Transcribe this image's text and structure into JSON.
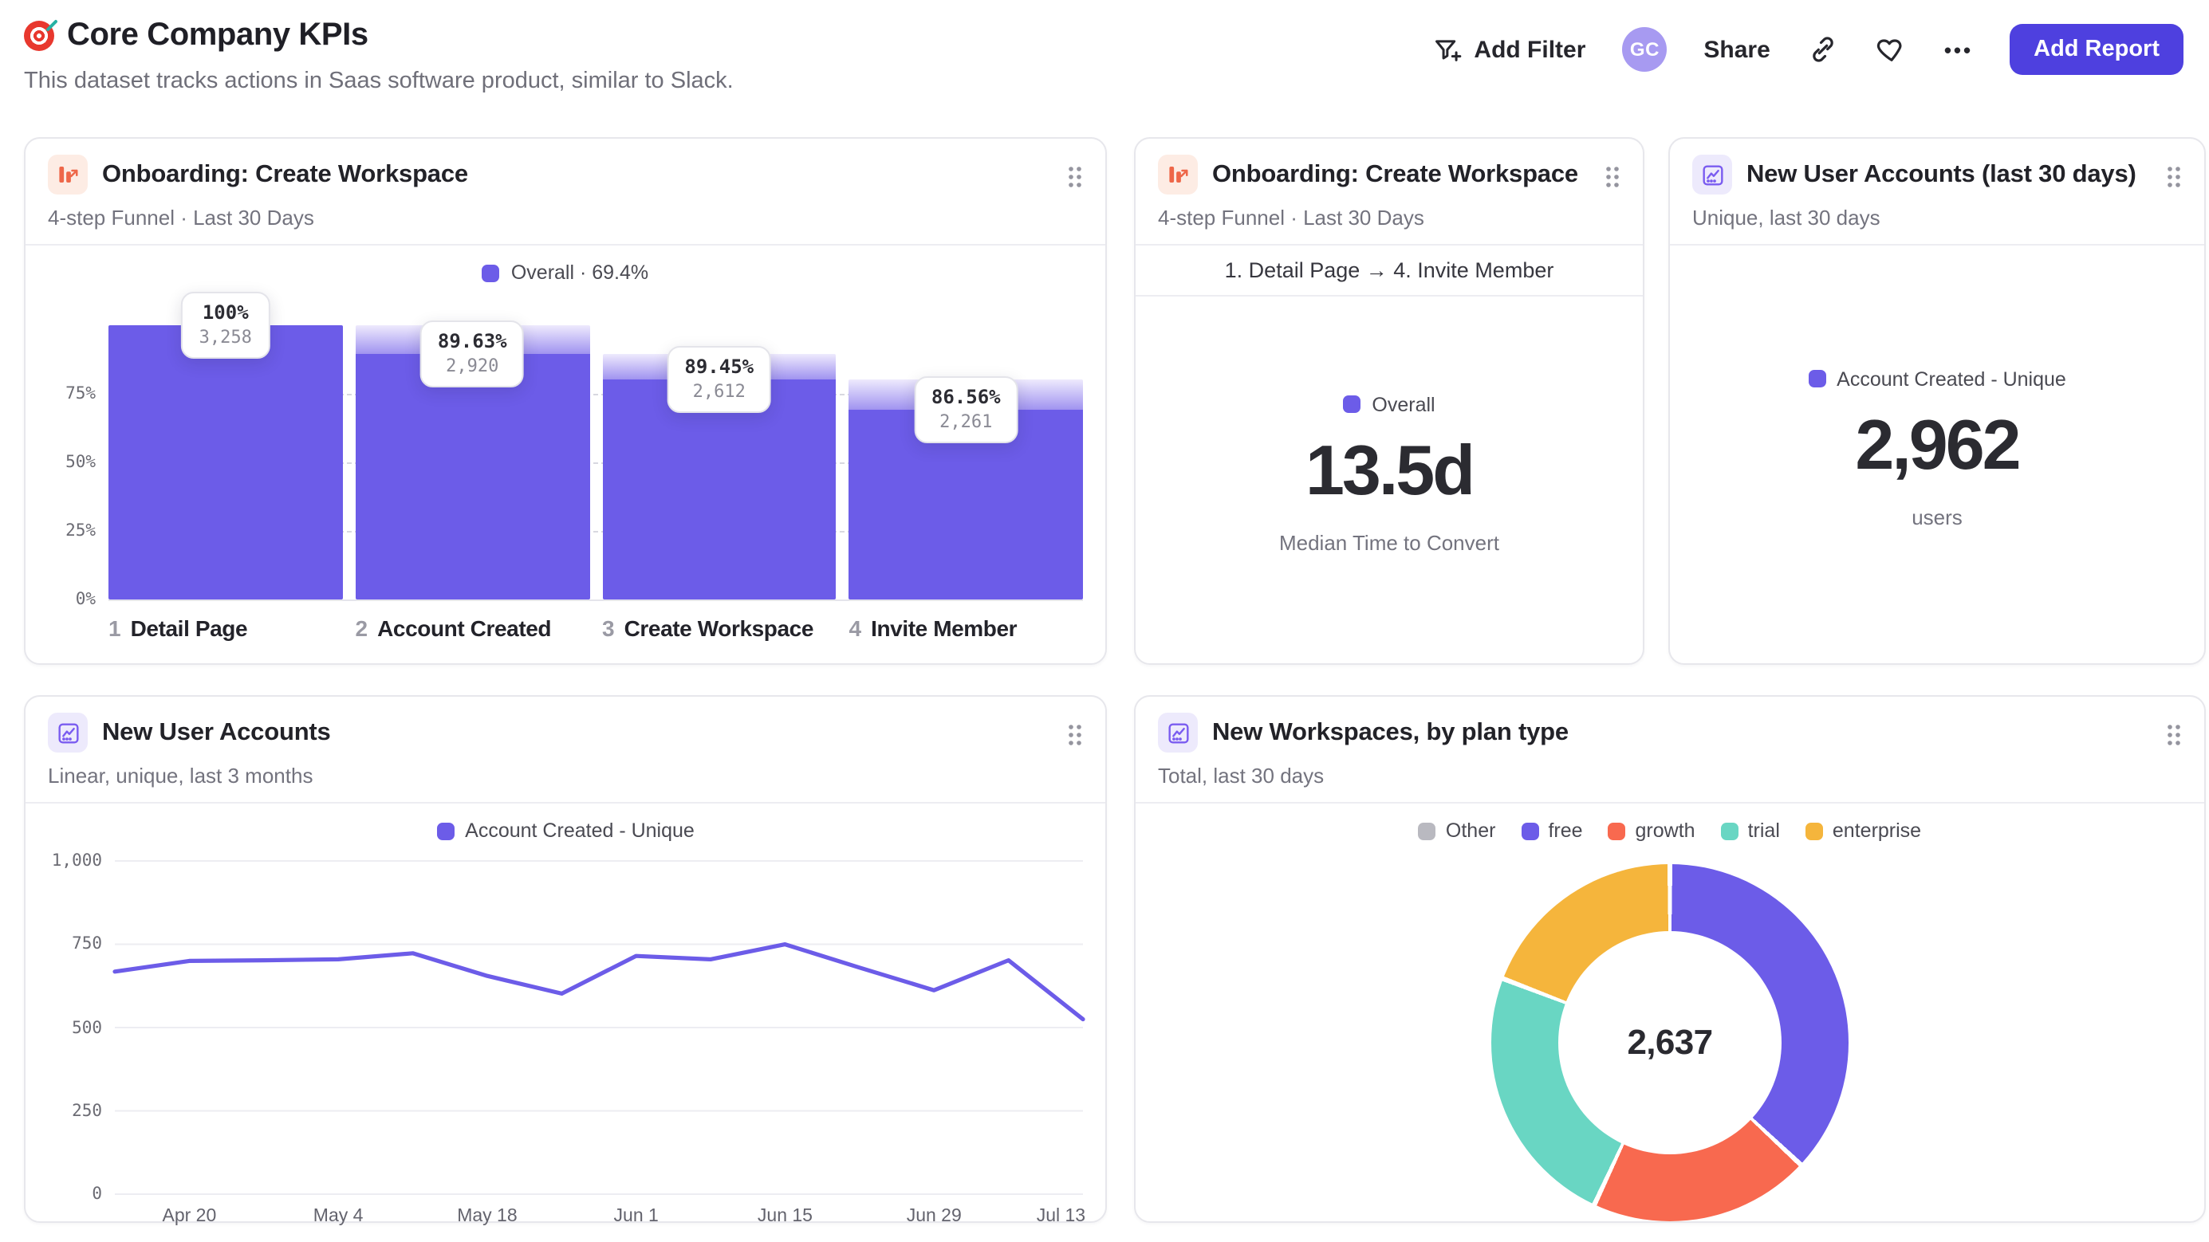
{
  "header": {
    "title": "Core Company KPIs",
    "subtitle": "This dataset tracks actions in Saas software product, similar to Slack.",
    "actions": {
      "add_filter": "Add Filter",
      "avatar_initials": "GC",
      "share": "Share",
      "more": "•••",
      "add_report": "Add Report"
    }
  },
  "colors": {
    "accent_purple": "#6c5ce8",
    "accent_purple_light": "#eeeafd",
    "coral": "#f8694f",
    "teal": "#69d6c3",
    "amber": "#f5b53c",
    "legend_gray": "#b9b9c0",
    "cta_indigo": "#4e40df",
    "avatar_bg": "#a79af1",
    "icon_orange": "#ee6749",
    "icon_orange_bg": "#fdece4",
    "icon_purple": "#7a5cf0",
    "icon_purple_bg": "#edeafc"
  },
  "chart_data": [
    {
      "id": "onboarding-funnel",
      "type": "bar",
      "title": "Onboarding: Create Workspace",
      "subtitle": "4-step Funnel · Last 30 Days",
      "legend_label": "Overall · 69.4%",
      "overall_conversion_pct": 69.4,
      "y_ticks": [
        "75%",
        "50%",
        "25%",
        "0%"
      ],
      "gridlines_pct": [
        75,
        50,
        25
      ],
      "ylim": [
        0,
        100
      ],
      "steps": [
        {
          "index": "1",
          "label": "Detail Page",
          "conversion_pct": "100%",
          "count": "3,258",
          "count_value": 3258,
          "pct_of_first": 100,
          "prev_pct_of_first": 100
        },
        {
          "index": "2",
          "label": "Account Created",
          "conversion_pct": "89.63%",
          "count": "2,920",
          "count_value": 2920,
          "pct_of_first": 89.63,
          "prev_pct_of_first": 100
        },
        {
          "index": "3",
          "label": "Create Workspace",
          "conversion_pct": "89.45%",
          "count": "2,612",
          "count_value": 2612,
          "pct_of_first": 80.18,
          "prev_pct_of_first": 89.63
        },
        {
          "index": "4",
          "label": "Invite Member",
          "conversion_pct": "86.56%",
          "count": "2,261",
          "count_value": 2261,
          "pct_of_first": 69.4,
          "prev_pct_of_first": 80.18
        }
      ]
    },
    {
      "id": "median-time-to-convert",
      "type": "metric",
      "title": "Onboarding: Create Workspace",
      "subtitle": "4-step Funnel · Last 30 Days",
      "range_label": "1. Detail Page → 4. Invite Member",
      "legend_label": "Overall",
      "value": "13.5d",
      "caption": "Median Time to Convert"
    },
    {
      "id": "new-user-accounts-30d",
      "type": "metric",
      "title": "New User Accounts (last 30 days)",
      "subtitle": "Unique, last 30 days",
      "legend_label": "Account Created - Unique",
      "value": "2,962",
      "caption": "users"
    },
    {
      "id": "new-user-accounts-trend",
      "type": "line",
      "title": "New User Accounts",
      "subtitle": "Linear, unique, last 3 months",
      "legend_label": "Account Created - Unique",
      "ylim": [
        0,
        1000
      ],
      "y_ticks": [
        "1,000",
        "750",
        "500",
        "250",
        "0"
      ],
      "x_tick_labels": [
        "Apr 20",
        "May 4",
        "May 18",
        "Jun 1",
        "Jun 15",
        "Jun 29",
        "Jul 13"
      ],
      "x_weekly_dates": [
        "Apr 13",
        "Apr 20",
        "Apr 27",
        "May 4",
        "May 11",
        "May 18",
        "May 25",
        "Jun 1",
        "Jun 8",
        "Jun 15",
        "Jun 22",
        "Jun 29",
        "Jul 6",
        "Jul 13"
      ],
      "values": [
        668,
        700,
        702,
        705,
        723,
        655,
        602,
        715,
        705,
        750,
        680,
        612,
        702,
        525
      ]
    },
    {
      "id": "new-workspaces-by-plan",
      "type": "pie",
      "title": "New Workspaces, by plan type",
      "subtitle": "Total, last 30 days",
      "total_label": "2,637",
      "total_value": 2637,
      "legend": [
        {
          "label": "Other",
          "color": "#b9b9c0"
        },
        {
          "label": "free",
          "color": "#6c5ce8"
        },
        {
          "label": "growth",
          "color": "#f8694f"
        },
        {
          "label": "trial",
          "color": "#69d6c3"
        },
        {
          "label": "enterprise",
          "color": "#f5b53c"
        }
      ],
      "segments": [
        {
          "label": "free",
          "value": 973,
          "color": "#6c5ce8",
          "start_deg": 0,
          "end_deg": 133
        },
        {
          "label": "growth",
          "value": 528,
          "color": "#f8694f",
          "start_deg": 133,
          "end_deg": 205
        },
        {
          "label": "trial",
          "value": 630,
          "color": "#69d6c3",
          "start_deg": 205,
          "end_deg": 291
        },
        {
          "label": "enterprise",
          "value": 506,
          "color": "#f5b53c",
          "start_deg": 291,
          "end_deg": 360
        }
      ]
    }
  ]
}
